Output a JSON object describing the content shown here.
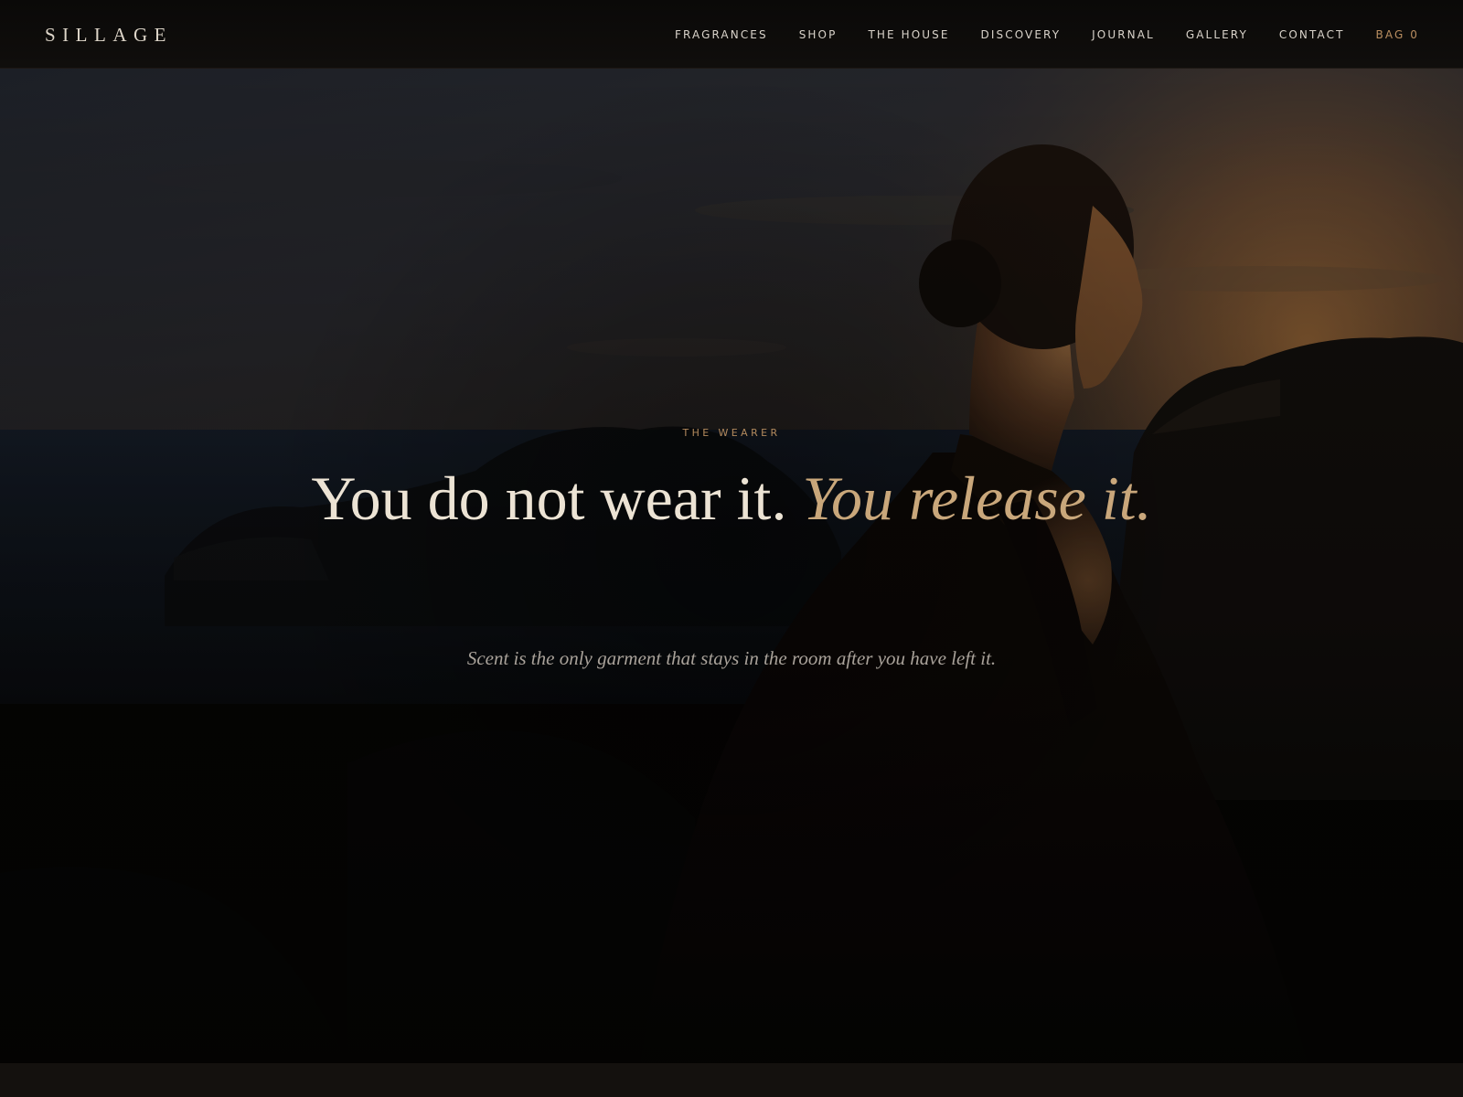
{
  "brand": {
    "logo": "SILLAGE"
  },
  "nav": {
    "items": [
      {
        "label": "FRAGRANCES"
      },
      {
        "label": "SHOP"
      },
      {
        "label": "THE HOUSE"
      },
      {
        "label": "DISCOVERY"
      },
      {
        "label": "JOURNAL"
      },
      {
        "label": "GALLERY"
      },
      {
        "label": "CONTACT"
      }
    ],
    "bag_label": "BAG 0"
  },
  "hero": {
    "eyebrow": "THE WEARER",
    "headline_main": "You do not wear it. ",
    "headline_accent": "You release it.",
    "subline": "Scent is the only garment that stays in the room after you have left it."
  },
  "colors": {
    "accent_gold": "#c9a77b",
    "eyebrow_gold": "#b38a5d",
    "bag_gold": "#b98e60",
    "headline_cream": "#ece3d4",
    "subline_grey": "#a9a29a",
    "background": "#0d0b09"
  }
}
